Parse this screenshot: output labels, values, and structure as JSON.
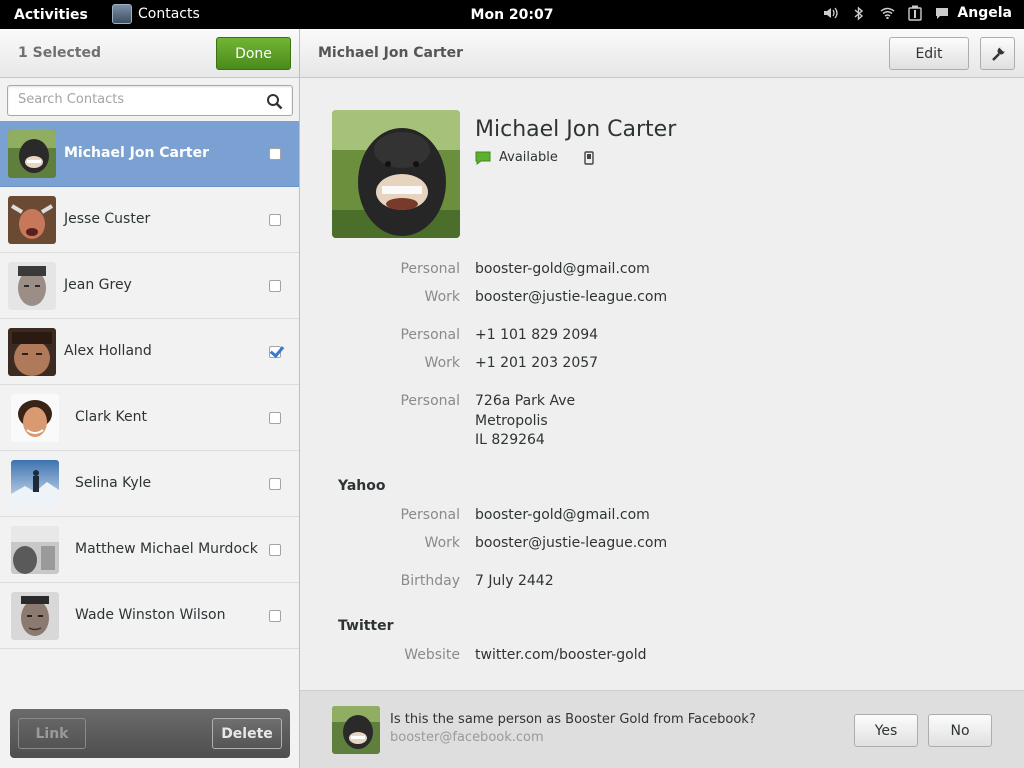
{
  "topbar": {
    "activities": "Activities",
    "app_name": "Contacts",
    "clock": "Mon 20:07",
    "user": "Angela",
    "tray_icons": [
      "volume-icon",
      "bluetooth-icon",
      "wifi-icon",
      "battery-icon",
      "chat-icon"
    ]
  },
  "left": {
    "selected_count": "1 Selected",
    "done_label": "Done",
    "search_placeholder": "Search Contacts",
    "contacts": [
      {
        "name": "Michael Jon Carter",
        "selected": true,
        "checked": false
      },
      {
        "name": "Jesse Custer",
        "selected": false,
        "checked": false
      },
      {
        "name": "Jean Grey",
        "selected": false,
        "checked": false
      },
      {
        "name": "Alex Holland",
        "selected": false,
        "checked": true
      },
      {
        "name": "Clark Kent",
        "selected": false,
        "checked": false
      },
      {
        "name": "Selina Kyle",
        "selected": false,
        "checked": false
      },
      {
        "name": "Matthew Michael Murdock",
        "selected": false,
        "checked": false
      },
      {
        "name": "Wade Winston Wilson",
        "selected": false,
        "checked": false
      }
    ],
    "link_label": "Link",
    "delete_label": "Delete"
  },
  "right": {
    "header_title": "Michael Jon Carter",
    "edit_label": "Edit",
    "contact": {
      "full_name": "Michael Jon Carter",
      "status": "Available",
      "emails": [
        {
          "label": "Personal",
          "value": "booster-gold@gmail.com"
        },
        {
          "label": "Work",
          "value": "booster@justie-league.com"
        }
      ],
      "phones": [
        {
          "label": "Personal",
          "value": "+1 101 829 2094"
        },
        {
          "label": "Work",
          "value": "+1 201 203 2057"
        }
      ],
      "address": {
        "label": "Personal",
        "line1": "726a Park Ave",
        "line2": "Metropolis",
        "line3": "IL 829264"
      },
      "yahoo": {
        "title": "Yahoo",
        "emails": [
          {
            "label": "Personal",
            "value": "booster-gold@gmail.com"
          },
          {
            "label": "Work",
            "value": "booster@justie-league.com"
          }
        ],
        "birthday_label": "Birthday",
        "birthday": "7 July 2442"
      },
      "twitter": {
        "title": "Twitter",
        "website_label": "Website",
        "website": "twitter.com/booster-gold"
      }
    },
    "link_suggestion": {
      "question": "Is this the same person as Booster Gold from Facebook?",
      "email": "booster@facebook.com",
      "yes_label": "Yes",
      "no_label": "No"
    }
  },
  "colors": {
    "selected_row": "#7aa1d2",
    "done_green": "#5a9e24",
    "topbar": "#000000"
  }
}
